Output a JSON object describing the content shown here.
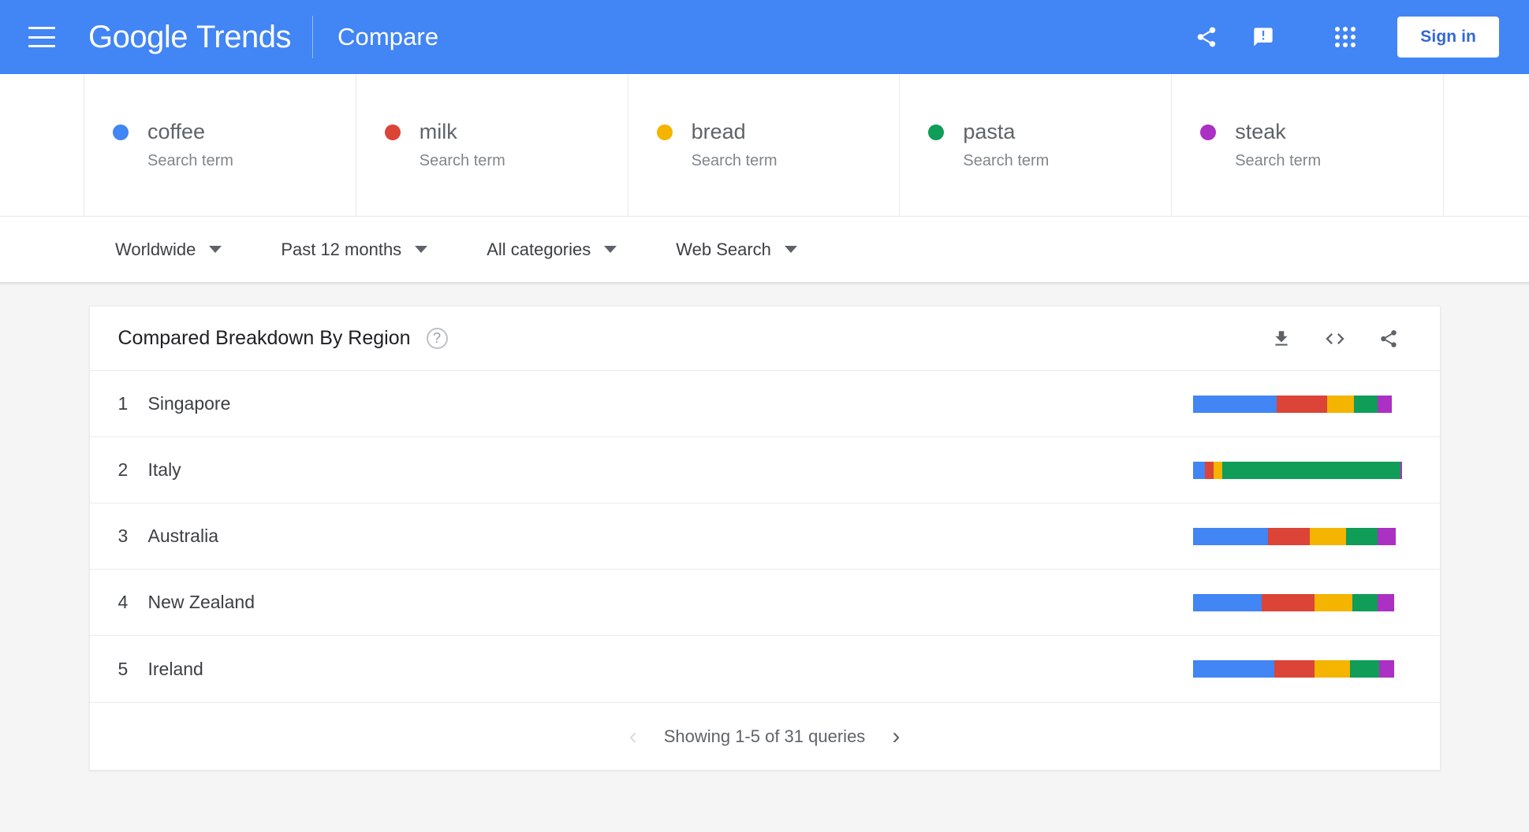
{
  "header": {
    "menu_icon": "hamburger-menu-icon",
    "logo_google": "Google",
    "logo_trends": "Trends",
    "page_title": "Compare",
    "share_icon": "share-icon",
    "feedback_icon": "feedback-icon",
    "apps_icon": "google-apps-grid-icon",
    "signin_label": "Sign in"
  },
  "terms": [
    {
      "name": "coffee",
      "type": "Search term",
      "color": "#4285F4"
    },
    {
      "name": "milk",
      "type": "Search term",
      "color": "#DB4437"
    },
    {
      "name": "bread",
      "type": "Search term",
      "color": "#F4B400"
    },
    {
      "name": "pasta",
      "type": "Search term",
      "color": "#0F9D58"
    },
    {
      "name": "steak",
      "type": "Search term",
      "color": "#AB30C4"
    }
  ],
  "filters": [
    {
      "label": "Worldwide",
      "name": "location-filter"
    },
    {
      "label": "Past 12 months",
      "name": "time-range-filter"
    },
    {
      "label": "All categories",
      "name": "category-filter"
    },
    {
      "label": "Web Search",
      "name": "search-type-filter"
    }
  ],
  "card": {
    "title": "Compared Breakdown By Region",
    "help_icon": "help-circle-icon",
    "download_icon": "download-icon",
    "embed_icon": "embed-code-icon",
    "share_icon": "share-icon",
    "footer": {
      "prev_label": "‹",
      "next_label": "›",
      "status": "Showing 1-5 of 31 queries"
    }
  },
  "chart_data": {
    "type": "bar",
    "title": "Compared Breakdown By Region",
    "stacked": true,
    "orientation": "horizontal",
    "legend": [
      "coffee",
      "milk",
      "bread",
      "pasta",
      "steak"
    ],
    "colors": [
      "#4285F4",
      "#DB4437",
      "#F4B400",
      "#0F9D58",
      "#AB30C4"
    ],
    "categories": [
      "Singapore",
      "Italy",
      "Australia",
      "New Zealand",
      "Ireland"
    ],
    "ranks": [
      1,
      2,
      3,
      4,
      5
    ],
    "series": [
      {
        "name": "coffee",
        "values": [
          40,
          6,
          36,
          33,
          39
        ]
      },
      {
        "name": "milk",
        "values": [
          24,
          4,
          20,
          25,
          19
        ]
      },
      {
        "name": "bread",
        "values": [
          13,
          4,
          17,
          18,
          17
        ]
      },
      {
        "name": "pasta",
        "values": [
          11,
          85,
          15,
          12,
          14
        ]
      },
      {
        "name": "steak",
        "values": [
          7,
          1,
          9,
          8,
          7
        ]
      }
    ],
    "unit": "percent",
    "total": 100,
    "xlabel": "",
    "ylabel": "",
    "grid": false
  }
}
